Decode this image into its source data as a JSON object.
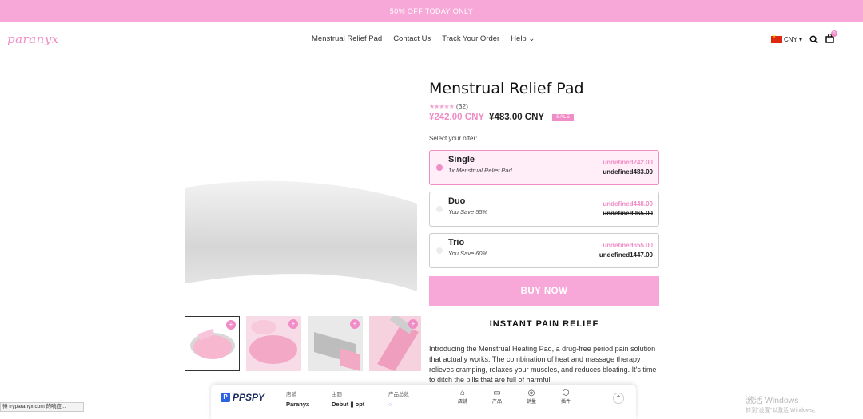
{
  "announcement": "50% OFF TODAY ONLY",
  "logo": "paranyx",
  "nav": [
    "Menstrual Relief Pad",
    "Contact Us",
    "Track Your Order",
    "Help ⌄"
  ],
  "currency": "CNY ▾",
  "cart_count": "0",
  "product": {
    "title": "Menstrual Relief Pad",
    "stars": "★★★★★",
    "reviews": "(32)",
    "price": "¥242.00 CNY",
    "old_price": "¥483.00 CNY",
    "sale_badge": "SALE",
    "offer_label": "Select your offer:",
    "offers": [
      {
        "name": "Single",
        "sub": "1x Menstrual Relief Pad",
        "price": "undefined242.00",
        "compare": "undefined483.00"
      },
      {
        "name": "Duo",
        "sub": "You Save 55%",
        "price": "undefined448.00",
        "compare": "undefined965.00"
      },
      {
        "name": "Trio",
        "sub": "You Save 60%",
        "price": "undefined655.00",
        "compare": "undefined1447.00"
      }
    ],
    "buy_button": "BUY NOW",
    "section_title": "INSTANT PAIN RELIEF",
    "description": "Introducing the Menstrual Heating Pad, a drug-free period pain solution that actually works. The combination of heat and massage therapy relieves cramping, relaxes your muscles, and reduces bloating. It's time to ditch the pills that are full of harmful"
  },
  "ppspy": {
    "brand": "PPSPY",
    "store_label": "店铺",
    "store_value": "Paranyx",
    "theme_label": "主题",
    "theme_value": "Debut || opt",
    "products_label": "产品总数",
    "icons": [
      {
        "icon": "home-icon",
        "label": "店铺"
      },
      {
        "icon": "bag-icon",
        "label": "产品"
      },
      {
        "icon": "sales-icon",
        "label": "销量"
      },
      {
        "icon": "plugin-icon",
        "label": "插件"
      }
    ]
  },
  "status_bar": "待 tryparanyx.com 的响应...",
  "windows_watermark": {
    "title": "激活 Windows",
    "sub": "转到\"设置\"以激活 Windows。"
  }
}
